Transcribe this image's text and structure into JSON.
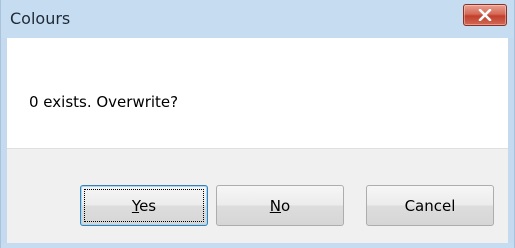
{
  "window": {
    "title": "Colours"
  },
  "message": {
    "text": "0 exists. Overwrite?"
  },
  "buttons": {
    "yes": {
      "mnemonic": "Y",
      "rest": "es"
    },
    "no": {
      "mnemonic": "N",
      "rest": "o"
    },
    "cancel": {
      "label": "Cancel"
    }
  },
  "colors": {
    "title_bar": "#c6dcf1",
    "close_button": "#c2402c",
    "button_area": "#f0f0f0",
    "default_button_border": "#3c7fb1"
  },
  "icons": {
    "close": "close-icon"
  }
}
